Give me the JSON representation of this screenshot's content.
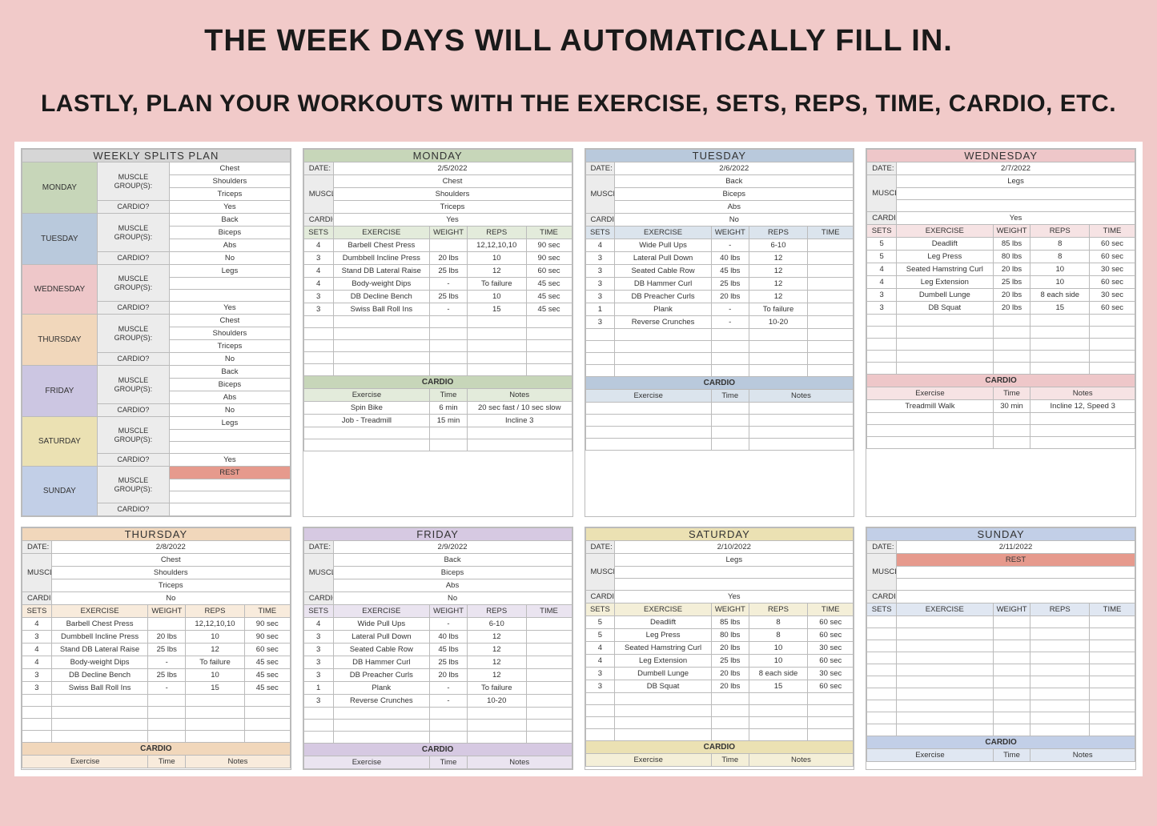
{
  "header": {
    "line1": "THE WEEK DAYS WILL AUTOMATICALLY FILL IN.",
    "line2": "LASTLY, PLAN YOUR WORKOUTS WITH THE EXERCISE, SETS, REPS, TIME, CARDIO, ETC."
  },
  "labels": {
    "date": "DATE:",
    "muscle_groups": "MUSCLE GROUP(S):",
    "cardio_q": "CARDIO?",
    "cardio": "CARDIO",
    "sets": "SETS",
    "exercise": "EXERCISE",
    "weight": "WEIGHT",
    "reps": "REPS",
    "time": "TIME",
    "cardio_exercise": "Exercise",
    "cardio_time": "Time",
    "cardio_notes": "Notes",
    "splits_title": "WEEKLY SPLITS PLAN",
    "rest": "REST"
  },
  "splits": [
    {
      "day": "MONDAY",
      "color": "c-green",
      "groups": [
        "Chest",
        "Shoulders",
        "Triceps"
      ],
      "cardio": "Yes"
    },
    {
      "day": "TUESDAY",
      "color": "c-blue",
      "groups": [
        "Back",
        "Biceps",
        "Abs"
      ],
      "cardio": "No"
    },
    {
      "day": "WEDNESDAY",
      "color": "c-pink",
      "groups": [
        "Legs",
        "",
        ""
      ],
      "cardio": "Yes"
    },
    {
      "day": "THURSDAY",
      "color": "c-orange",
      "groups": [
        "Chest",
        "Shoulders",
        "Triceps"
      ],
      "cardio": "No"
    },
    {
      "day": "FRIDAY",
      "color": "c-lilac",
      "groups": [
        "Back",
        "Biceps",
        "Abs"
      ],
      "cardio": "No"
    },
    {
      "day": "SATURDAY",
      "color": "c-yellow",
      "groups": [
        "Legs",
        "",
        ""
      ],
      "cardio": "Yes"
    },
    {
      "day": "SUNDAY",
      "color": "c-sky",
      "groups": [
        "",
        "",
        ""
      ],
      "cardio": "",
      "rest": true
    }
  ],
  "days": [
    {
      "name": "MONDAY",
      "date": "2/5/2022",
      "theme": "green",
      "groups": [
        "Chest",
        "Shoulders",
        "Triceps"
      ],
      "cardio_q": "Yes",
      "ex": [
        {
          "s": "4",
          "n": "Barbell Chest Press",
          "w": "",
          "r": "12,12,10,10",
          "t": "90 sec"
        },
        {
          "s": "3",
          "n": "Dumbbell Incline Press",
          "w": "20 lbs",
          "r": "10",
          "t": "90 sec"
        },
        {
          "s": "4",
          "n": "Stand DB Lateral Raise",
          "w": "25 lbs",
          "r": "12",
          "t": "60 sec"
        },
        {
          "s": "4",
          "n": "Body-weight Dips",
          "w": "-",
          "r": "To failure",
          "t": "45 sec"
        },
        {
          "s": "3",
          "n": "DB Decline Bench",
          "w": "25 lbs",
          "r": "10",
          "t": "45 sec"
        },
        {
          "s": "3",
          "n": "Swiss Ball Roll Ins",
          "w": "-",
          "r": "15",
          "t": "45 sec"
        }
      ],
      "cardio": [
        {
          "e": "Spin Bike",
          "t": "6 min",
          "n": "20 sec fast / 10 sec slow"
        },
        {
          "e": "Job - Treadmill",
          "t": "15 min",
          "n": "Incline 3"
        }
      ]
    },
    {
      "name": "TUESDAY",
      "date": "2/6/2022",
      "theme": "blue",
      "groups": [
        "Back",
        "Biceps",
        "Abs"
      ],
      "cardio_q": "No",
      "ex": [
        {
          "s": "4",
          "n": "Wide Pull Ups",
          "w": "-",
          "r": "6-10",
          "t": ""
        },
        {
          "s": "3",
          "n": "Lateral Pull Down",
          "w": "40 lbs",
          "r": "12",
          "t": ""
        },
        {
          "s": "3",
          "n": "Seated Cable Row",
          "w": "45 lbs",
          "r": "12",
          "t": ""
        },
        {
          "s": "3",
          "n": "DB Hammer Curl",
          "w": "25 lbs",
          "r": "12",
          "t": ""
        },
        {
          "s": "3",
          "n": "DB Preacher Curls",
          "w": "20 lbs",
          "r": "12",
          "t": ""
        },
        {
          "s": "1",
          "n": "Plank",
          "w": "-",
          "r": "To failure",
          "t": ""
        },
        {
          "s": "3",
          "n": "Reverse Crunches",
          "w": "-",
          "r": "10-20",
          "t": ""
        }
      ],
      "cardio": []
    },
    {
      "name": "WEDNESDAY",
      "date": "2/7/2022",
      "theme": "pink",
      "groups": [
        "Legs",
        "",
        ""
      ],
      "cardio_q": "Yes",
      "ex": [
        {
          "s": "5",
          "n": "Deadlift",
          "w": "85 lbs",
          "r": "8",
          "t": "60 sec"
        },
        {
          "s": "5",
          "n": "Leg Press",
          "w": "80 lbs",
          "r": "8",
          "t": "60 sec"
        },
        {
          "s": "4",
          "n": "Seated Hamstring Curl",
          "w": "20 lbs",
          "r": "10",
          "t": "30 sec"
        },
        {
          "s": "4",
          "n": "Leg Extension",
          "w": "25 lbs",
          "r": "10",
          "t": "60 sec"
        },
        {
          "s": "3",
          "n": "Dumbell Lunge",
          "w": "20 lbs",
          "r": "8 each side",
          "t": "30 sec"
        },
        {
          "s": "3",
          "n": "DB Squat",
          "w": "20 lbs",
          "r": "15",
          "t": "60 sec"
        }
      ],
      "cardio": [
        {
          "e": "Treadmill Walk",
          "t": "30 min",
          "n": "Incline 12, Speed 3"
        }
      ]
    },
    {
      "name": "THURSDAY",
      "date": "2/8/2022",
      "theme": "orange",
      "groups": [
        "Chest",
        "Shoulders",
        "Triceps"
      ],
      "cardio_q": "No",
      "ex": [
        {
          "s": "4",
          "n": "Barbell Chest Press",
          "w": "",
          "r": "12,12,10,10",
          "t": "90 sec"
        },
        {
          "s": "3",
          "n": "Dumbbell Incline Press",
          "w": "20 lbs",
          "r": "10",
          "t": "90 sec"
        },
        {
          "s": "4",
          "n": "Stand DB Lateral Raise",
          "w": "25 lbs",
          "r": "12",
          "t": "60 sec"
        },
        {
          "s": "4",
          "n": "Body-weight Dips",
          "w": "-",
          "r": "To failure",
          "t": "45 sec"
        },
        {
          "s": "3",
          "n": "DB Decline Bench",
          "w": "25 lbs",
          "r": "10",
          "t": "45 sec"
        },
        {
          "s": "3",
          "n": "Swiss Ball Roll Ins",
          "w": "-",
          "r": "15",
          "t": "45 sec"
        }
      ],
      "cardio": [],
      "row2": true
    },
    {
      "name": "FRIDAY",
      "date": "2/9/2022",
      "theme": "purple",
      "groups": [
        "Back",
        "Biceps",
        "Abs"
      ],
      "cardio_q": "No",
      "ex": [
        {
          "s": "4",
          "n": "Wide Pull Ups",
          "w": "-",
          "r": "6-10",
          "t": ""
        },
        {
          "s": "3",
          "n": "Lateral Pull Down",
          "w": "40 lbs",
          "r": "12",
          "t": ""
        },
        {
          "s": "3",
          "n": "Seated Cable Row",
          "w": "45 lbs",
          "r": "12",
          "t": ""
        },
        {
          "s": "3",
          "n": "DB Hammer Curl",
          "w": "25 lbs",
          "r": "12",
          "t": ""
        },
        {
          "s": "3",
          "n": "DB Preacher Curls",
          "w": "20 lbs",
          "r": "12",
          "t": ""
        },
        {
          "s": "1",
          "n": "Plank",
          "w": "-",
          "r": "To failure",
          "t": ""
        },
        {
          "s": "3",
          "n": "Reverse Crunches",
          "w": "-",
          "r": "10-20",
          "t": ""
        }
      ],
      "cardio": [],
      "row2": true
    },
    {
      "name": "SATURDAY",
      "date": "2/10/2022",
      "theme": "yellow",
      "groups": [
        "Legs",
        "",
        ""
      ],
      "cardio_q": "Yes",
      "ex": [
        {
          "s": "5",
          "n": "Deadlift",
          "w": "85 lbs",
          "r": "8",
          "t": "60 sec"
        },
        {
          "s": "5",
          "n": "Leg Press",
          "w": "80 lbs",
          "r": "8",
          "t": "60 sec"
        },
        {
          "s": "4",
          "n": "Seated Hamstring Curl",
          "w": "20 lbs",
          "r": "10",
          "t": "30 sec"
        },
        {
          "s": "4",
          "n": "Leg Extension",
          "w": "25 lbs",
          "r": "10",
          "t": "60 sec"
        },
        {
          "s": "3",
          "n": "Dumbell Lunge",
          "w": "20 lbs",
          "r": "8 each side",
          "t": "30 sec"
        },
        {
          "s": "3",
          "n": "DB Squat",
          "w": "20 lbs",
          "r": "15",
          "t": "60 sec"
        }
      ],
      "cardio": [],
      "row2": true
    },
    {
      "name": "SUNDAY",
      "date": "2/11/2022",
      "theme": "sky",
      "groups": [
        "",
        "",
        ""
      ],
      "cardio_q": "",
      "rest": true,
      "ex": [],
      "cardio": [],
      "row2": true
    }
  ]
}
